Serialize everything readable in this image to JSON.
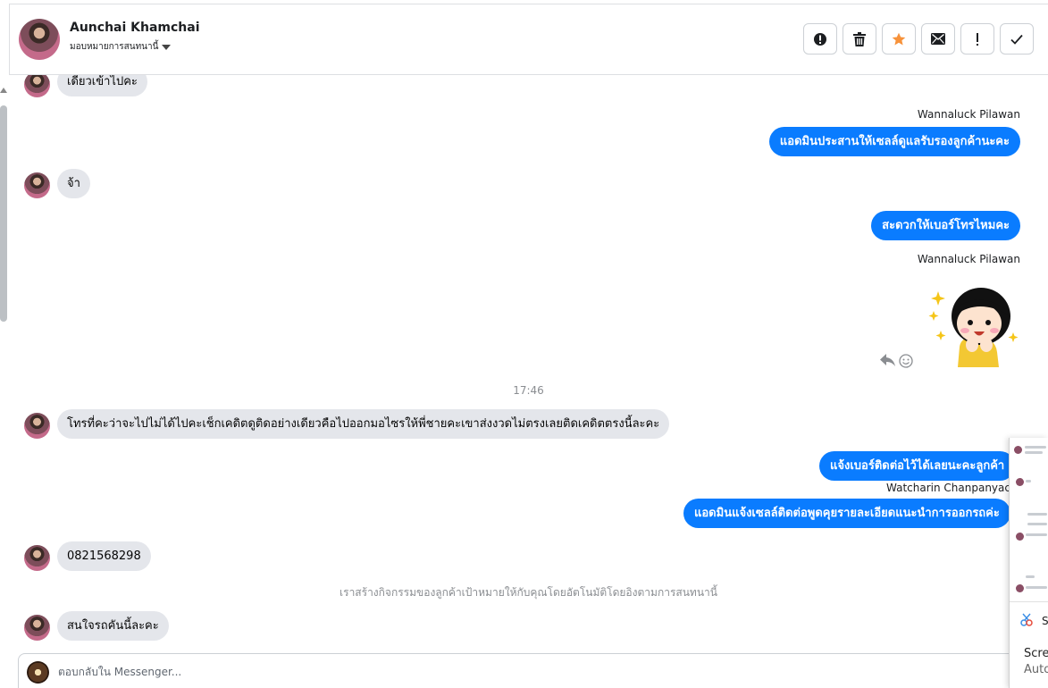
{
  "header": {
    "contact_name": "Aunchai Khamchai",
    "assign_label": "มอบหมายการสนทนานี้",
    "actions": [
      {
        "name": "spam",
        "icon": "alert-circle-icon"
      },
      {
        "name": "delete",
        "icon": "trash-icon"
      },
      {
        "name": "star",
        "icon": "star-icon",
        "color": "#f7923a"
      },
      {
        "name": "mark-unread",
        "icon": "mail-icon"
      },
      {
        "name": "important",
        "icon": "exclamation-icon"
      },
      {
        "name": "done",
        "icon": "check-icon"
      }
    ]
  },
  "messages": {
    "m1": "เดี๋ยวเข้าไปคะ",
    "s1": "Wannaluck Pilawan",
    "o1": "แอดมินประสานให้เซลล์ดูแลรับรองลูกค้านะคะ",
    "m2": "จ้า",
    "o2": "สะดวกให้เบอร์โทรไหมคะ",
    "s2": "Wannaluck Pilawan",
    "time": "17:46",
    "m3": "โทรที่คะว่าจะไปไม่ได้ไปคะเช็กเคดิตดูติดอย่างเดียวคือไปออกมอไซรให้พี่ชายคะเขาส่งงวดไม่ตรงเลยติดเคดิตตรงนี้ละคะ",
    "o3": "แจ้งเบอร์ติดต่อไว้ได้เลยนะคะลูกค้า",
    "s3": "Watcharin Chanpanyacho",
    "o4": "แอดมินแจ้งเซลล์ติดต่อพูดคุยรายละเอียดแนะนำการออกรถค่ะ",
    "m4": "0821568298",
    "sysnote": "เราสร้างกิจกรรมของลูกค้าเป้าหมายให้กับคุณโดยอัตโนมัติโดยอิงตามการสนทนานี้",
    "m5": "สนใจรถคันนี้ละคะ"
  },
  "composer": {
    "placeholder": "ตอบกลับใน Messenger..."
  },
  "screenshot_popup": {
    "title_fragment": "S",
    "line1": "Scree",
    "line2": "Auto"
  },
  "colors": {
    "outgoing_bubble": "#0a7cff",
    "incoming_bubble": "#e4e6eb",
    "star": "#f7923a"
  }
}
